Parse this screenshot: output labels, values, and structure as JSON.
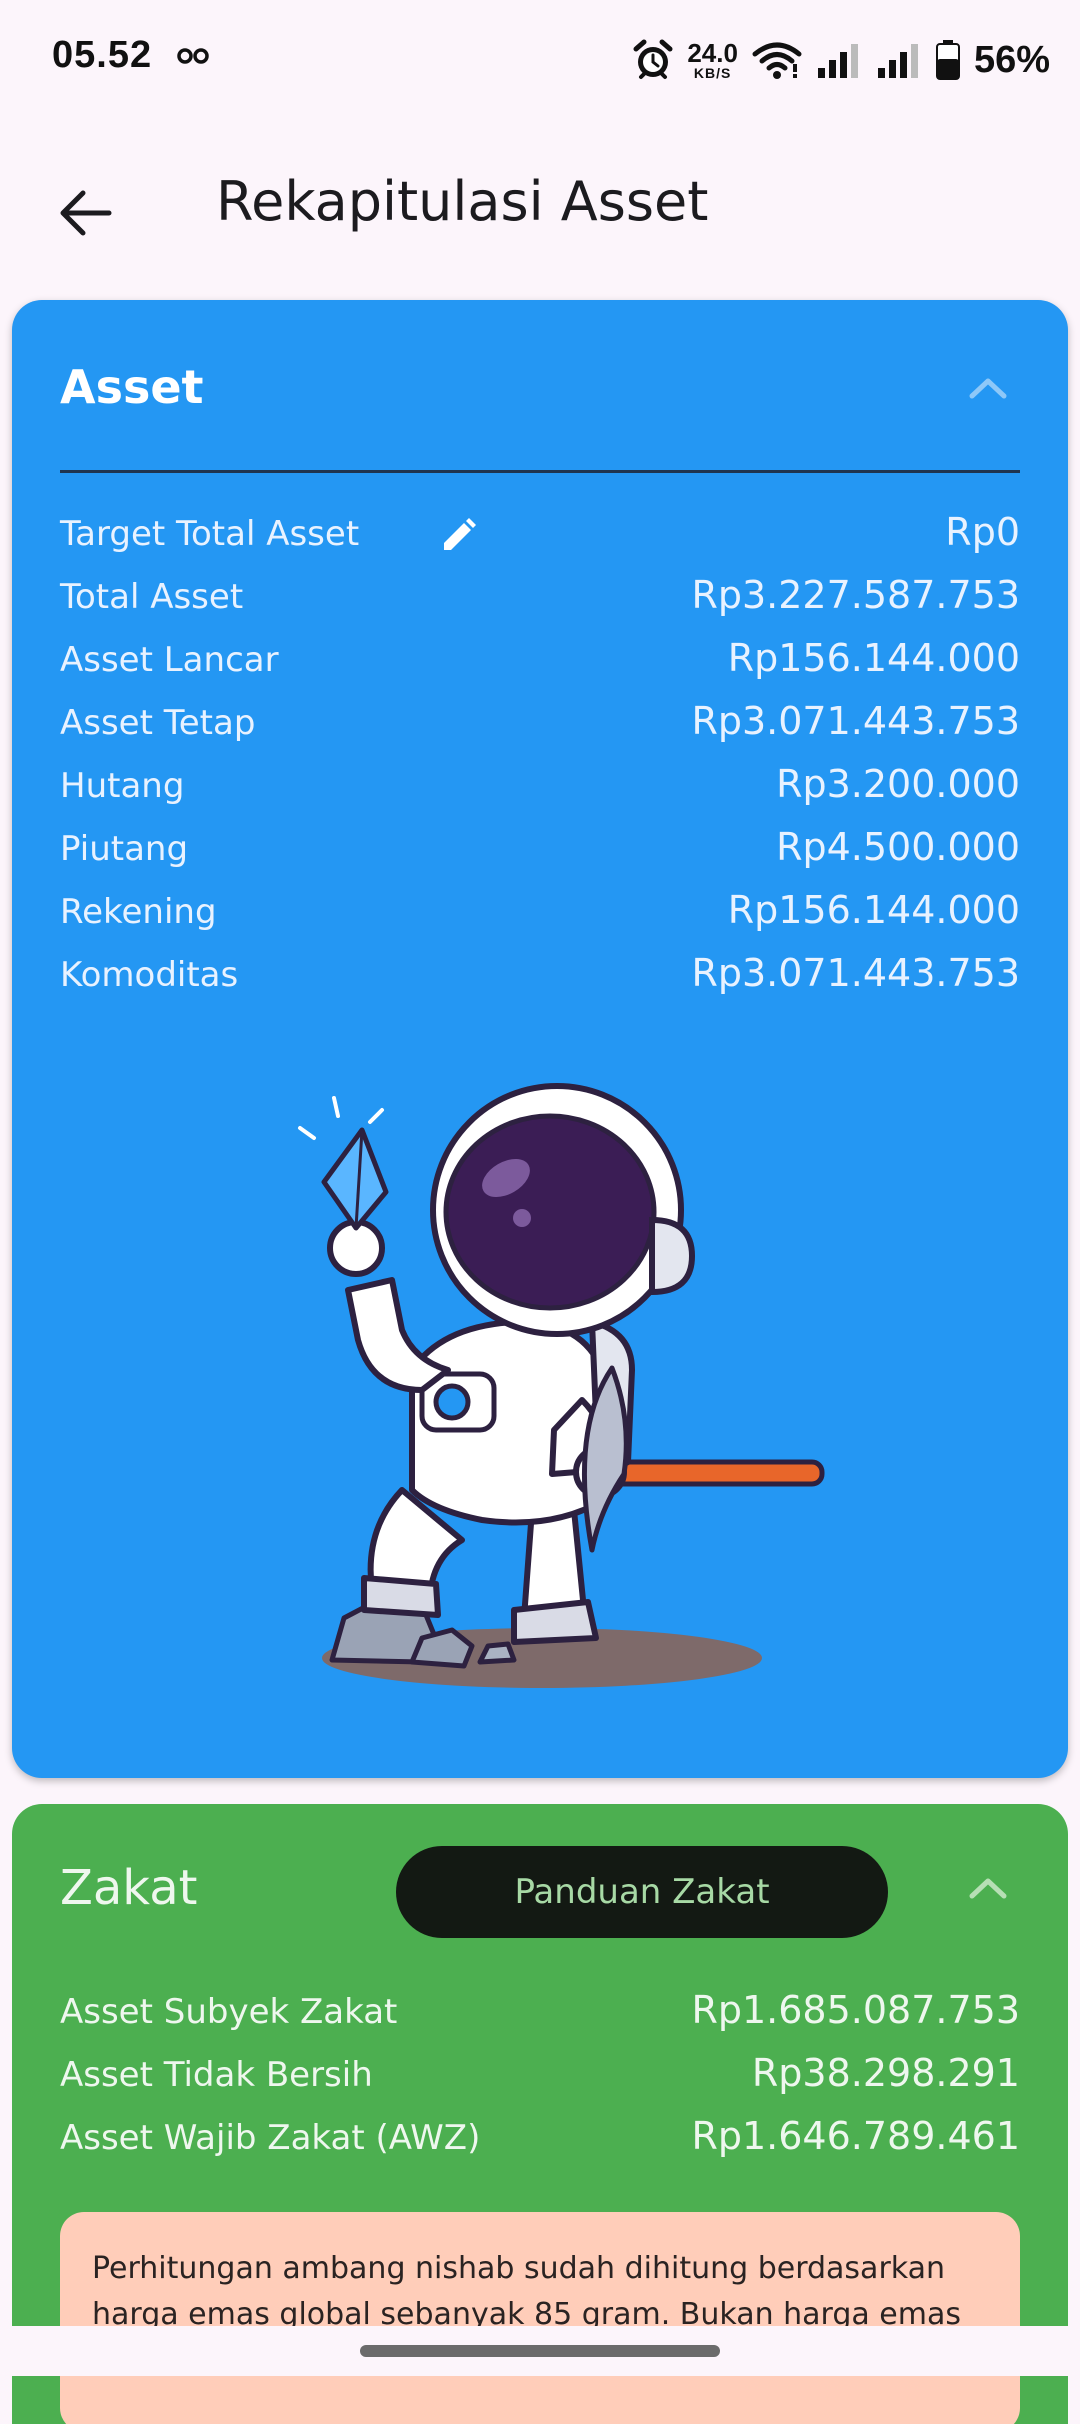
{
  "status_bar": {
    "time": "05.52",
    "net_speed_value": "24.0",
    "net_speed_unit": "KB/S",
    "battery": "56%"
  },
  "app_bar": {
    "title": "Rekapitulasi Asset"
  },
  "asset_card": {
    "title": "Asset",
    "rows": [
      {
        "label": "Target Total Asset",
        "value": "Rp0"
      },
      {
        "label": "Total Asset",
        "value": "Rp3.227.587.753"
      },
      {
        "label": "Asset Lancar",
        "value": "Rp156.144.000"
      },
      {
        "label": "Asset Tetap",
        "value": "Rp3.071.443.753"
      },
      {
        "label": "Hutang",
        "value": "Rp3.200.000"
      },
      {
        "label": "Piutang",
        "value": "Rp4.500.000"
      },
      {
        "label": "Rekening",
        "value": "Rp156.144.000"
      },
      {
        "label": "Komoditas",
        "value": "Rp3.071.443.753"
      }
    ],
    "color": "#2497F3"
  },
  "zakat_card": {
    "title": "Zakat",
    "guide_button": "Panduan Zakat",
    "rows": [
      {
        "label": "Asset Subyek Zakat",
        "value": "Rp1.685.087.753"
      },
      {
        "label": "Asset Tidak Bersih",
        "value": "Rp38.298.291"
      },
      {
        "label": "Asset Wajib Zakat (AWZ)",
        "value": "Rp1.646.789.461"
      }
    ],
    "notice_line_1": "Perhitungan ambang nishab sudah dihitung berdasarkan",
    "notice_line_2": "harga emas global sebanyak 85 gram. Bukan harga emas",
    "color": "#4CAF50"
  }
}
